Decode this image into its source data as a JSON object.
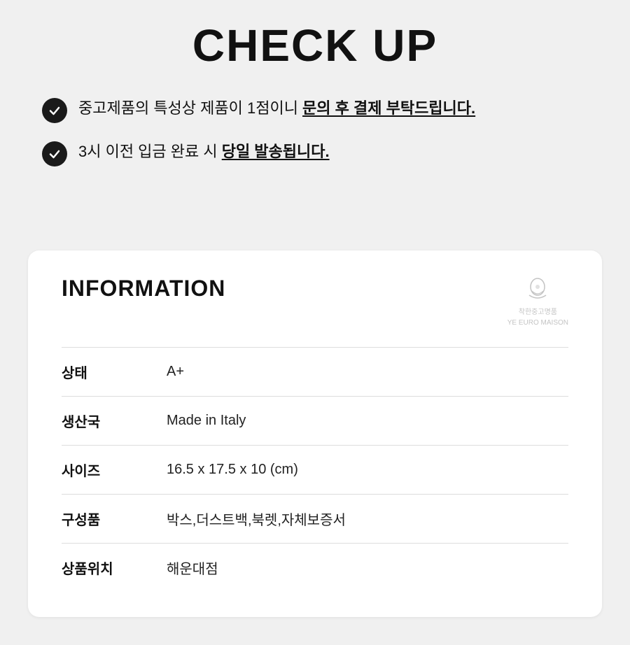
{
  "header": {
    "title": "CHECK UP"
  },
  "checkItems": [
    {
      "id": 1,
      "text_before": "중고제품의 특성상 제품이 1점이니 ",
      "text_highlight": "문의 후 결제 부탁드립니다.",
      "text_after": ""
    },
    {
      "id": 2,
      "text_before": "3시 이전 입금 완료 시 ",
      "text_highlight": "당일 발송됩니다.",
      "text_after": ""
    }
  ],
  "information": {
    "section_title": "INFORMATION",
    "brand_name": "착한중고명품",
    "brand_sub": "YE EURO MAISON",
    "rows": [
      {
        "label": "상태",
        "value": "A+"
      },
      {
        "label": "생산국",
        "value": "Made in Italy"
      },
      {
        "label": "사이즈",
        "value": "16.5 x 17.5 x 10 (cm)"
      },
      {
        "label": "구성품",
        "value": "박스,더스트백,북렛,자체보증서"
      },
      {
        "label": "상품위치",
        "value": "해운대점"
      }
    ]
  }
}
